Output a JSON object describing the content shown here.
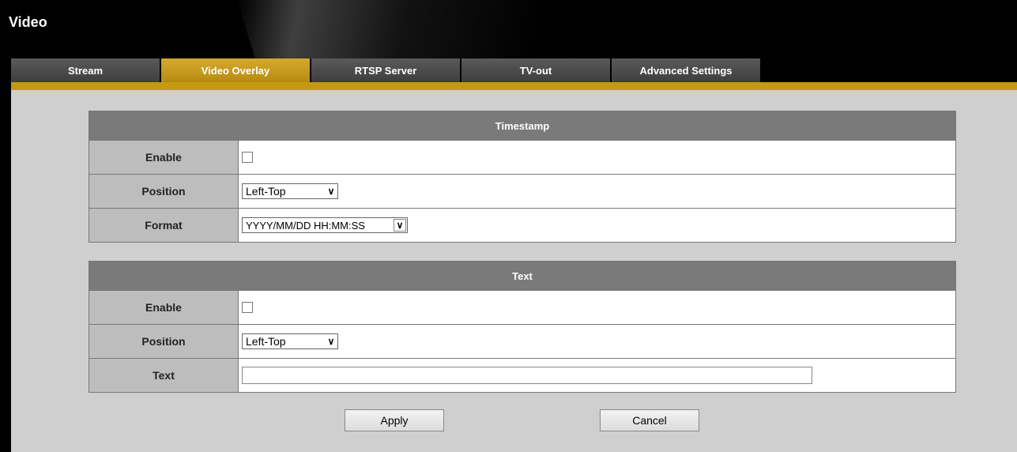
{
  "page": {
    "title": "Video"
  },
  "tabs": [
    {
      "label": "Stream",
      "active": false
    },
    {
      "label": "Video Overlay",
      "active": true
    },
    {
      "label": "RTSP Server",
      "active": false
    },
    {
      "label": "TV-out",
      "active": false
    },
    {
      "label": "Advanced Settings",
      "active": false
    }
  ],
  "timestamp": {
    "header": "Timestamp",
    "enable_label": "Enable",
    "enable_checked": false,
    "position_label": "Position",
    "position_value": "Left-Top",
    "format_label": "Format",
    "format_value": "YYYY/MM/DD HH:MM:SS"
  },
  "text": {
    "header": "Text",
    "enable_label": "Enable",
    "enable_checked": false,
    "position_label": "Position",
    "position_value": "Left-Top",
    "text_label": "Text",
    "text_value": ""
  },
  "actions": {
    "apply": "Apply",
    "cancel": "Cancel"
  },
  "colors": {
    "active_tab": "#c49a10",
    "tab": "#4a4a4a",
    "header_row": "#7a7a7a",
    "label_cell": "#bdbdbd",
    "background": "#cfcfcf"
  }
}
